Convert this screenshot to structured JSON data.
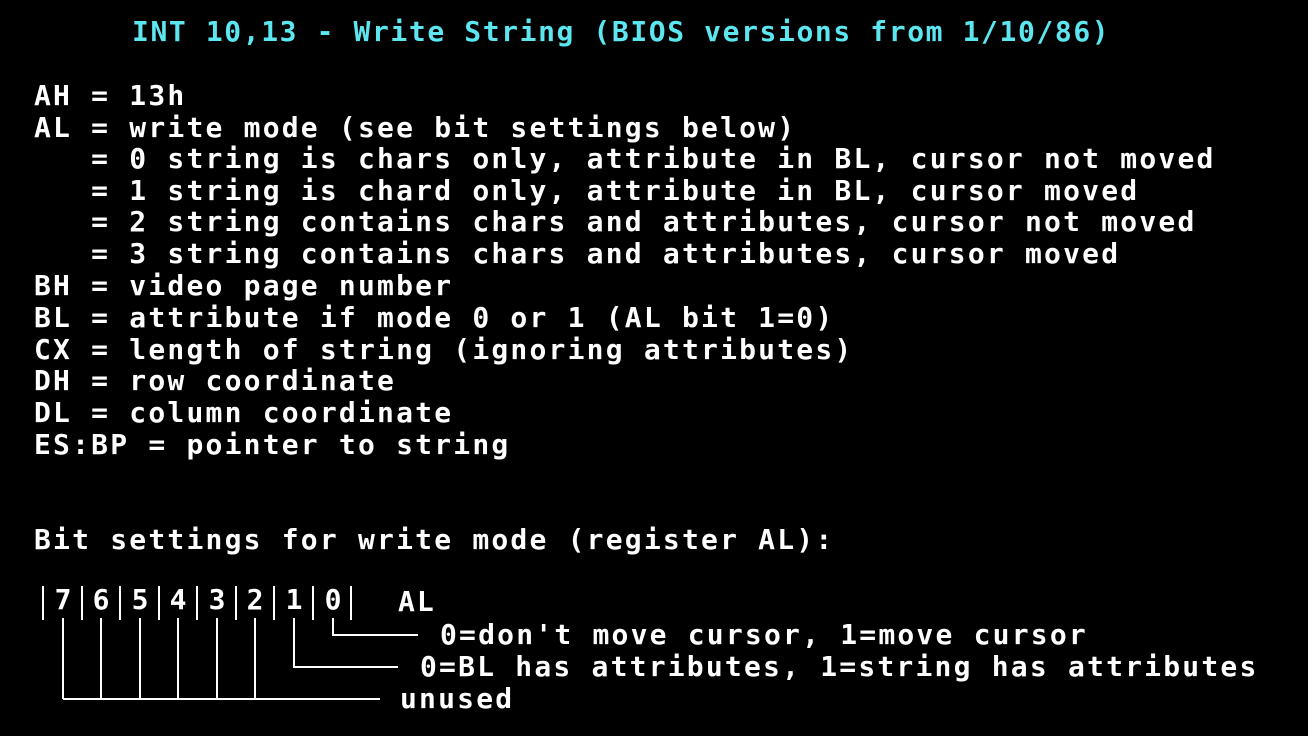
{
  "title": "INT 10,13 - Write String (BIOS versions from 1/10/86)",
  "params": [
    "AH = 13h",
    "AL = write mode (see bit settings below)",
    "   = 0 string is chars only, attribute in BL, cursor not moved",
    "   = 1 string is chard only, attribute in BL, cursor moved",
    "   = 2 string contains chars and attributes, cursor not moved",
    "   = 3 string contains chars and attributes, cursor moved",
    "BH = video page number",
    "BL = attribute if mode 0 or 1 (AL bit 1=0)",
    "CX = length of string (ignoring attributes)",
    "DH = row coordinate",
    "DL = column coordinate",
    "ES:BP = pointer to string"
  ],
  "bit_heading": "Bit settings for write mode (register AL):",
  "bit_diagram": {
    "bits": [
      "7",
      "6",
      "5",
      "4",
      "3",
      "2",
      "1",
      "0"
    ],
    "register": "AL",
    "bit0_desc": "0=don't move cursor, 1=move cursor",
    "bit1_desc": "0=BL has attributes, 1=string has attributes",
    "unused_desc": "unused"
  },
  "colors": {
    "background": "#000000",
    "title": "#5ce6f0",
    "text": "#ffffff"
  }
}
